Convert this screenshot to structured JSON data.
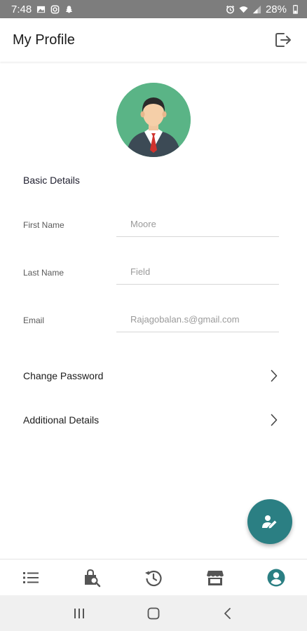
{
  "status_bar": {
    "time": "7:48",
    "battery": "28%",
    "left_icons": [
      "image-icon",
      "instagram-icon",
      "snapchat-icon"
    ],
    "right_icons": [
      "alarm-icon",
      "wifi-icon",
      "signal-icon",
      "battery-icon"
    ]
  },
  "app_bar": {
    "title": "My Profile",
    "action_icon": "logout-icon"
  },
  "profile": {
    "avatar_icon": "user-avatar-icon",
    "avatar_bg": "#5ab486",
    "section_title": "Basic Details",
    "fields": [
      {
        "label": "First Name",
        "value": "Moore"
      },
      {
        "label": "Last Name",
        "value": "Field"
      },
      {
        "label": "Email",
        "value": "Rajagobalan.s@gmail.com"
      }
    ],
    "links": [
      {
        "label": "Change Password",
        "icon": "chevron-right-icon"
      },
      {
        "label": "Additional Details",
        "icon": "chevron-right-icon"
      }
    ]
  },
  "fab": {
    "icon": "edit-profile-icon",
    "color": "#2b7f83"
  },
  "bottom_nav": {
    "active_color": "#2b7f83",
    "inactive_color": "#555555",
    "items": [
      {
        "icon": "list-icon",
        "active": false
      },
      {
        "icon": "shopping-search-icon",
        "active": false
      },
      {
        "icon": "history-icon",
        "active": false
      },
      {
        "icon": "store-icon",
        "active": false
      },
      {
        "icon": "account-circle-icon",
        "active": true
      }
    ]
  },
  "system_nav": {
    "icons": [
      "recents-icon",
      "home-icon",
      "back-icon"
    ]
  }
}
